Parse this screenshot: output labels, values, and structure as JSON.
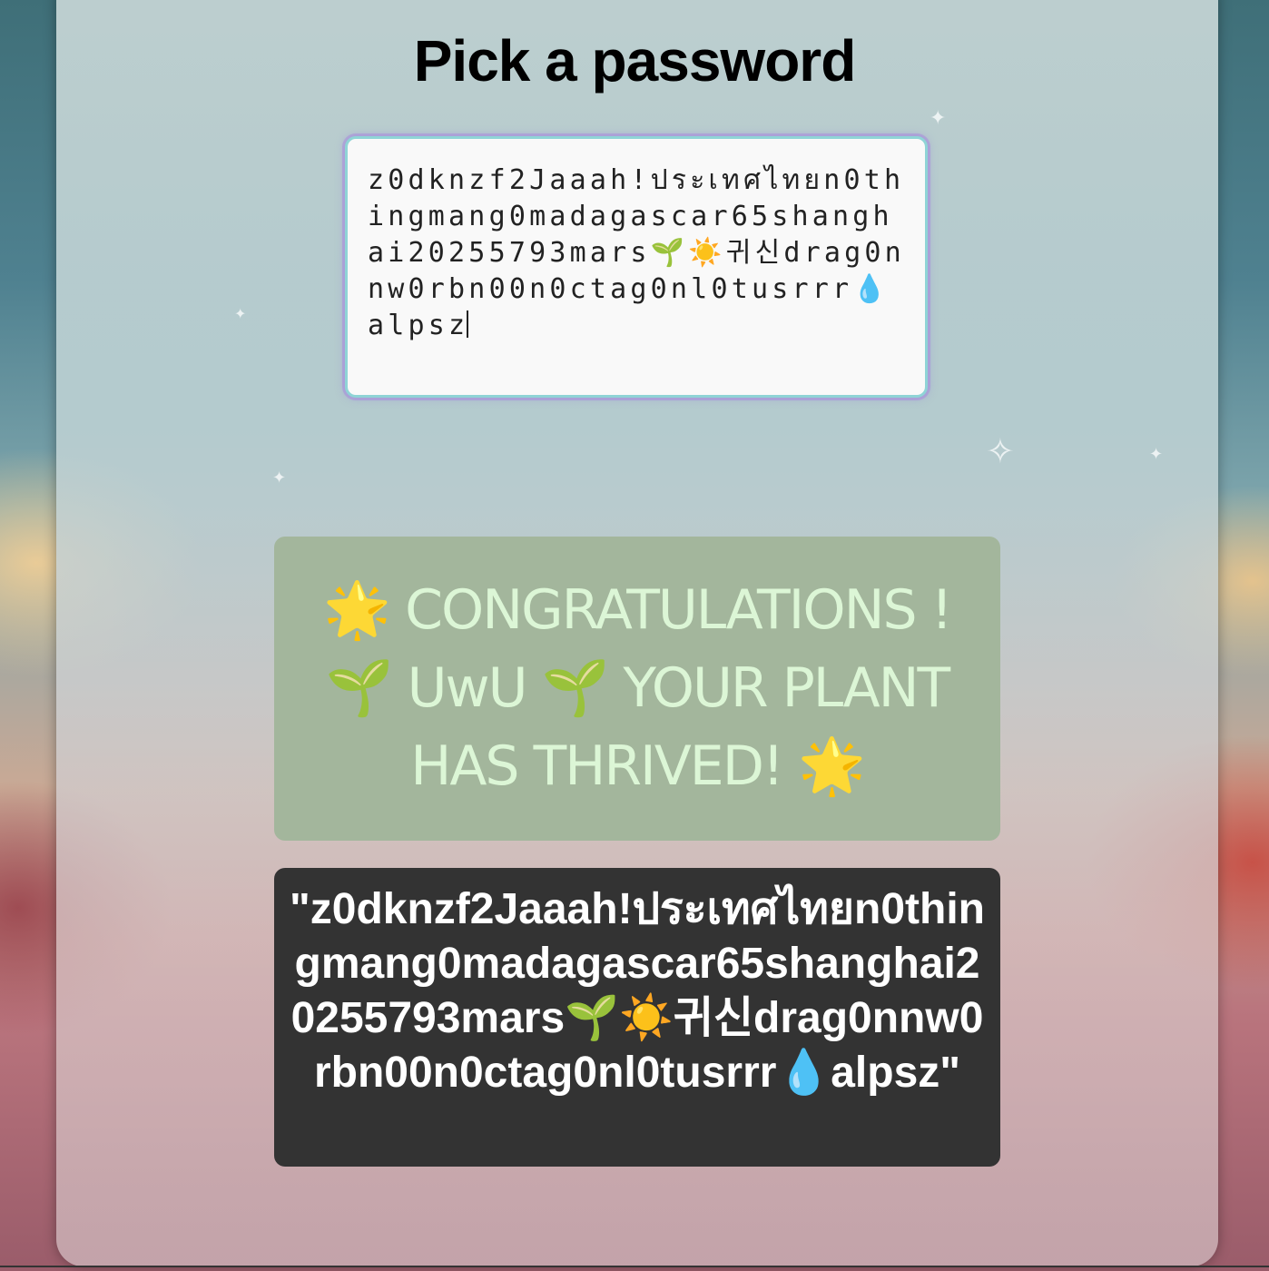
{
  "page": {
    "title": "Pick a password"
  },
  "password_input": {
    "value": "z0dknzf2Jaaah!ประเทศไทยn0thingmang0madagascar65shanghai20255793mars🌱☀️귀신drag0nnw0rbn00n0ctag0nl0tusrrr💧alpsz"
  },
  "result": {
    "congrats_message": "🌟 CONGRATULATIONS ! 🌱 UwU 🌱 YOUR PLANT HAS THRIVED! 🌟",
    "password_echo": "\"z0dknzf2Jaaah!ประเทศไทยn0thingmang0madagascar65shanghai20255793mars🌱☀️귀신drag0nnw0rbn00n0ctag0nl0tusrrr💧alpsz\""
  },
  "colors": {
    "congrats_bg": "#a3b69c",
    "congrats_text": "#dcf6d6",
    "echo_bg": "#333333",
    "input_border": "#8fd4d6"
  }
}
